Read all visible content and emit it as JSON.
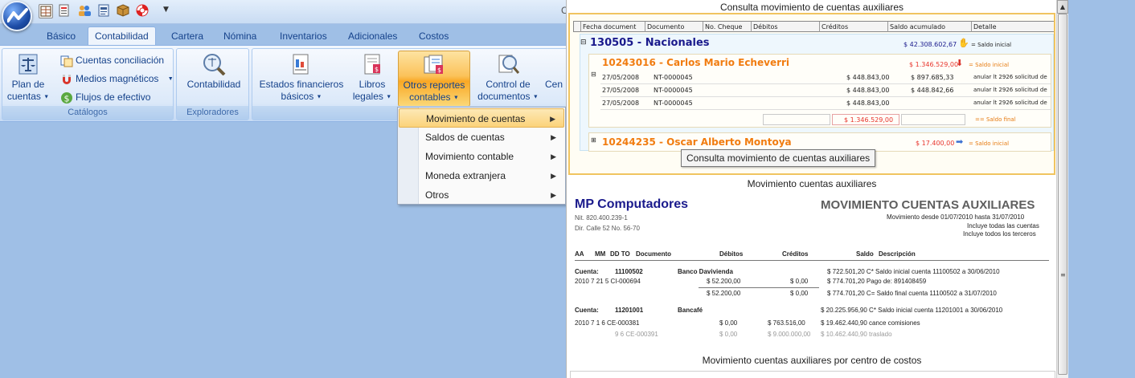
{
  "colors": {
    "workspace": "#9fbfe6",
    "ribbon": "#dbe8f9",
    "tab_text": "#15428b",
    "hot": "#fbc25a",
    "brand_blue": "#1a1a8c",
    "accent_orange": "#f17c10"
  },
  "titlebar": {
    "app_icon": "app-logo-icon",
    "qat_icons": [
      "table-icon",
      "document-icon",
      "users-icon",
      "report-icon",
      "box-icon",
      "help-lifebuoy-icon"
    ],
    "title_fragment": "C"
  },
  "tabs": [
    "Básico",
    "Contabilidad",
    "Cartera",
    "Nómina",
    "Inventarios",
    "Adicionales",
    "Costos"
  ],
  "active_tab": "Contabilidad",
  "ribbon": {
    "catalogos": {
      "label": "Catálogos",
      "plan_label_1": "Plan de",
      "plan_label_2": "cuentas",
      "cuentas_conciliacion": "Cuentas conciliación",
      "medios_magneticos": "Medios magnéticos",
      "flujos_efectivo": "Flujos de efectivo"
    },
    "exploradores": {
      "label": "Exploradores",
      "contabilidad": "Contabilidad"
    },
    "reportes": {
      "estados_1": "Estados financieros",
      "estados_2": "básicos",
      "libros_1": "Libros",
      "libros_2": "legales",
      "otros_1": "Otros reportes",
      "otros_2": "contables",
      "control_1": "Control de",
      "control_2": "documentos",
      "cen": "Cen"
    }
  },
  "menu": {
    "items": [
      "Movimiento de cuentas",
      "Saldos de cuentas",
      "Movimiento contable",
      "Moneda extranjera",
      "Otros"
    ],
    "selected": 0
  },
  "preview": {
    "titles": [
      "Consulta movimiento de cuentas auxiliares",
      "Movimiento cuentas auxiliares",
      "Movimiento cuentas auxiliares por centro de costos"
    ],
    "tooltip": "Consulta movimiento de cuentas auxiliares",
    "grid": {
      "headers": [
        "Fecha document",
        "Documento",
        "No. Cheque",
        "Débitos",
        "Créditos",
        "Saldo acumulado",
        "Detalle"
      ],
      "group_code": "130505 - Nacionales",
      "group_saldo": "$ 42.308.602,67",
      "saldo_inicial": "= Saldo inicial",
      "sub1": "10243016 - Carlos Mario Echeverri",
      "sub1_saldo": "$ 1.346.529,00",
      "rows": [
        {
          "fecha": "27/05/2008",
          "doc": "NT-0000045",
          "deb": "$ 448.843,00",
          "saldo": "$ 897.685,33",
          "det": "anular lt 2926 solicitud de"
        },
        {
          "fecha": "27/05/2008",
          "doc": "NT-0000045",
          "deb": "$ 448.843,00",
          "saldo": "$ 448.842,66",
          "det": "anular lt 2926 solicitud de"
        },
        {
          "fecha": "27/05/2008",
          "doc": "NT-0000045",
          "deb": "$ 448.843,00",
          "saldo": "",
          "det": "anular lt 2926 solicitud de"
        }
      ],
      "total": "$ 1.346.529,00",
      "saldo_final": "== Saldo final",
      "sub2": "10244235 - Oscar Alberto Montoya",
      "sub2_saldo": "$ 17.400,00"
    },
    "report": {
      "company": "MP Computadores",
      "nit": "Nit. 820.400.239-1",
      "address": "Dir. Calle 52 No. 56-70",
      "title": "MOVIMIENTO CUENTAS AUXILIARES",
      "range": "Movimiento desde 01/07/2010 hasta 31/07/2010",
      "incl1": "Incluye todas las cuentas",
      "incl2": "Incluye todos los terceros",
      "col_aa": "AA",
      "col_mm": "MM",
      "col_ddto": "DD TO",
      "col_doc": "Documento",
      "col_deb": "Débitos",
      "col_cred": "Créditos",
      "col_saldo": "Saldo",
      "col_desc": "Descripción",
      "cuenta_lbl": "Cuenta:",
      "c1_code": "11100502",
      "c1_name": "Banco Davivienda",
      "c1_ini": "$ 722.501,20 C*  Saldo inicial cuenta 11100502 a 30/06/2010",
      "r1_date": "2010   7   21  5  CI-000694",
      "r1_deb": "$ 52.200,00",
      "r1_cred": "$ 0,00",
      "r1_saldo": "$ 774.701,20 Pago de: 891408459",
      "t1_deb": "$ 52.200,00",
      "t1_cred": "$ 0,00",
      "t1_fin": "$ 774.701,20 C=  Saldo final cuenta 11100502 a 31/07/2010",
      "c2_code": "11201001",
      "c2_name": "Bancafé",
      "c2_ini": "$ 20.225.956,90 C*  Saldo inicial cuenta 11201001 a 30/06/2010",
      "r2_date": "2010   7    1   6  CE-000381",
      "r2_deb": "$ 0,00",
      "r2_cred": "$ 763.516,00",
      "r2_saldo": "$ 19.462.440,90 cance comisiones",
      "r3_date": "9   6  CE-000391",
      "r3_deb": "$ 0,00",
      "r3_cred": "$ 9.000.000,00",
      "r3_saldo": "$ 10.462.440,90 traslado"
    }
  }
}
